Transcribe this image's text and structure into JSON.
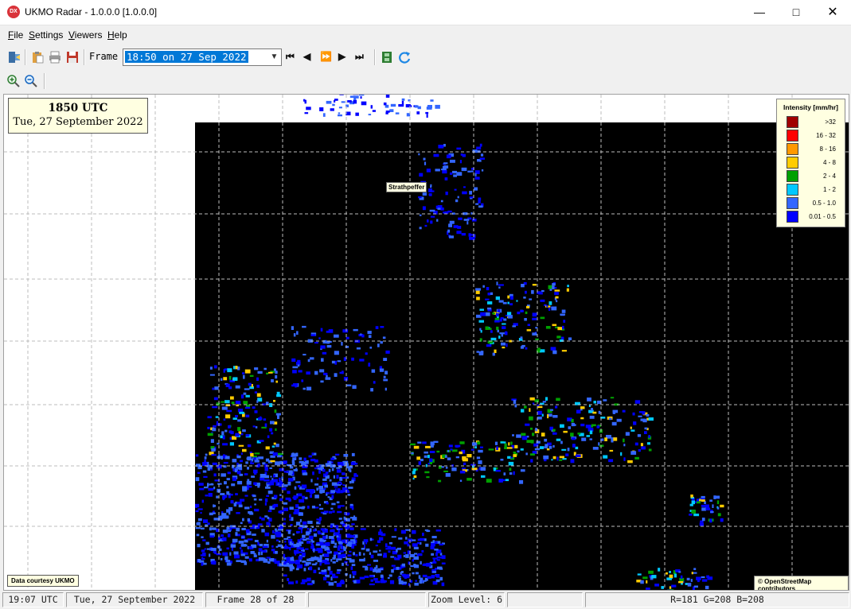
{
  "window": {
    "title": "UKMO Radar - 1.0.0.0 [1.0.0.0]",
    "app_icon_text": "DX"
  },
  "menu": [
    {
      "label": "File",
      "key": "F",
      "rest": "ile"
    },
    {
      "label": "Settings",
      "key": "S",
      "rest": "ettings"
    },
    {
      "label": "Viewers",
      "key": "V",
      "rest": "iewers"
    },
    {
      "label": "Help",
      "key": "H",
      "rest": "elp"
    }
  ],
  "toolbar": {
    "frame_label": "Frame",
    "frame_value": "18:50 on 27 Sep 2022",
    "nav": {
      "first": "⏮",
      "prev": "◀",
      "play": "⏩",
      "next": "▶",
      "last": "⏭"
    }
  },
  "map": {
    "time_title": "1850 UTC",
    "date_text": "Tue, 27 September 2022",
    "place_label": "Strathpeffer",
    "courtesy": "Data courtesy UKMO",
    "attribution": "© OpenStreetMap contributors",
    "legend": {
      "title": "Intensity [mm/hr]",
      "items": [
        {
          "label": ">32",
          "color": "#a00000"
        },
        {
          "label": "16 - 32",
          "color": "#ff0000"
        },
        {
          "label": "8 - 16",
          "color": "#ff9900"
        },
        {
          "label": "4 - 8",
          "color": "#ffcc00"
        },
        {
          "label": "2 - 4",
          "color": "#00a000"
        },
        {
          "label": "1 - 2",
          "color": "#00c8ff"
        },
        {
          "label": "0.5 - 1.0",
          "color": "#3366ff"
        },
        {
          "label": "0.01 - 0.5",
          "color": "#0000ff"
        }
      ]
    }
  },
  "status": {
    "utc_time": "19:07 UTC",
    "date": "Tue, 27 September 2022",
    "frame": "Frame 28 of 28",
    "blank": "",
    "zoom": "Zoom Level: 6",
    "blank2": "",
    "rgb": "R=181 G=208 B=208"
  }
}
